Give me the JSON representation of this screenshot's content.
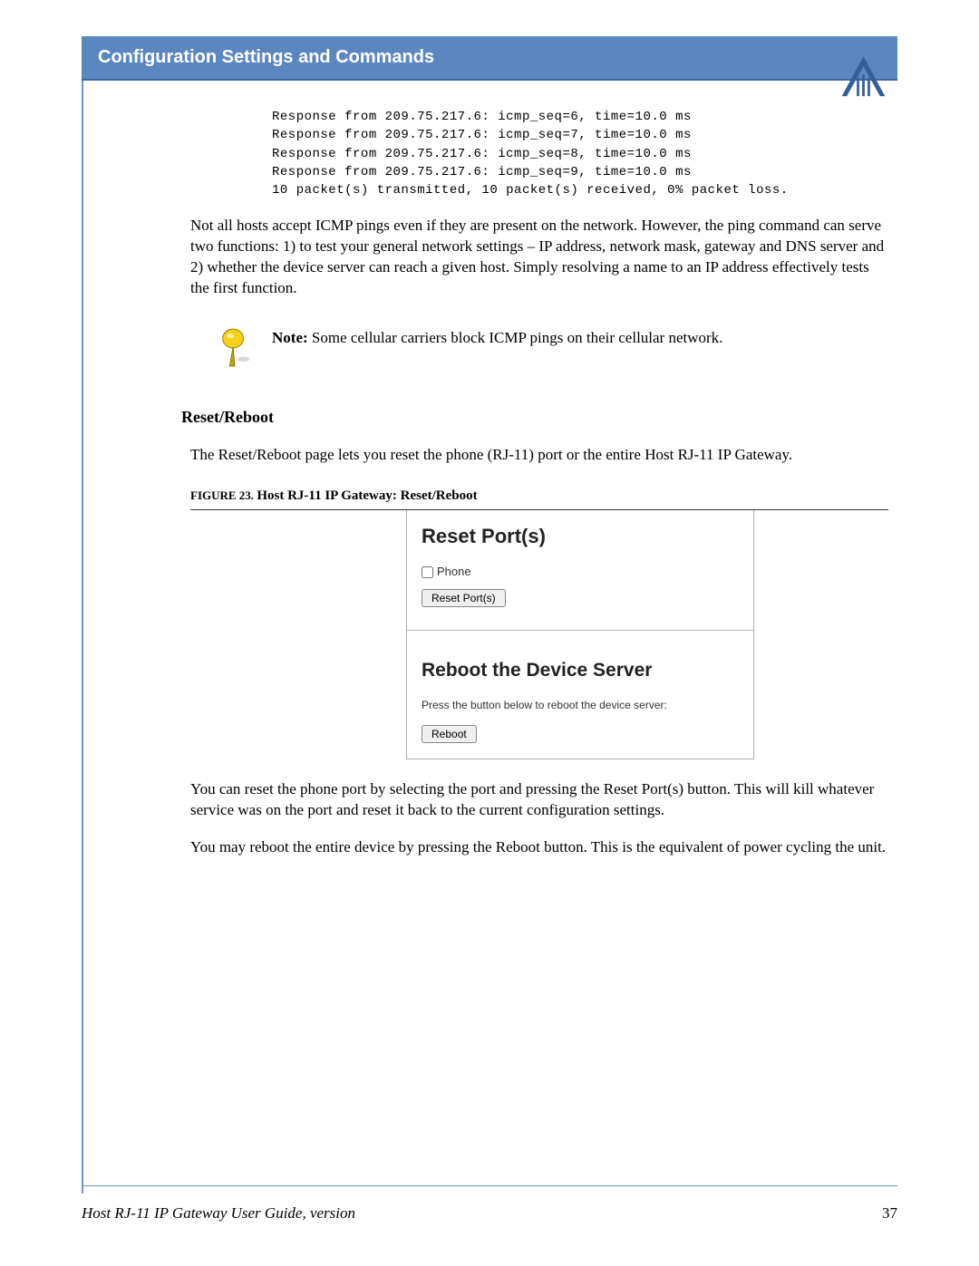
{
  "header": {
    "title": "Configuration Settings and Commands"
  },
  "ping": {
    "lines": [
      "Response from 209.75.217.6: icmp_seq=6, time=10.0 ms",
      "Response from 209.75.217.6: icmp_seq=7, time=10.0 ms",
      "Response from 209.75.217.6: icmp_seq=8, time=10.0 ms",
      "Response from 209.75.217.6: icmp_seq=9, time=10.0 ms",
      "10 packet(s) transmitted, 10 packet(s) received, 0% packet loss."
    ]
  },
  "para1": "Not all hosts accept ICMP pings even if they are present on the network. However, the ping command can serve two functions: 1) to test your general network settings – IP address, network mask, gateway and DNS server and 2) whether the device server can reach a given host. Simply resolving a name to an IP address effectively tests the first function.",
  "note": {
    "label": "Note:",
    "text": " Some cellular carriers block ICMP pings on their cellular network."
  },
  "section": {
    "title": "Reset/Reboot",
    "intro": "The Reset/Reboot page lets you reset the phone (RJ-11) port or the entire Host RJ-11 IP Gateway."
  },
  "figure": {
    "caption_prefix": "FIGURE 23. ",
    "caption": "Host RJ-11 IP Gateway: Reset/Reboot",
    "reset_heading": "Reset Port(s)",
    "checkbox_label": "Phone",
    "reset_button": "Reset Port(s)",
    "reboot_heading": "Reboot the Device Server",
    "reboot_instruction": "Press the button below to reboot the device server:",
    "reboot_button": "Reboot"
  },
  "para2": "You can reset the phone port by selecting the port and pressing the Reset Port(s) button. This will kill whatever service was on the port and reset it back to the current configuration settings.",
  "para3": "You may reboot the entire device by pressing the Reboot button. This is the equivalent of power cycling the unit.",
  "footer": {
    "title": "Host RJ-11 IP Gateway User Guide, version",
    "page": "37"
  }
}
